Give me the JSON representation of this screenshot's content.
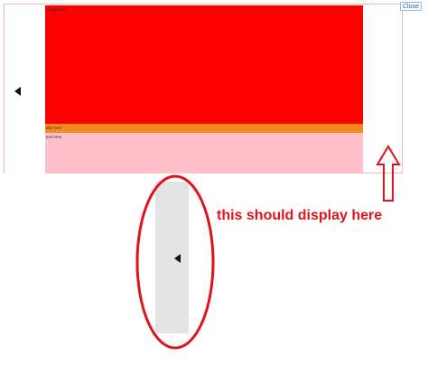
{
  "panel": {
    "red_text": "image here",
    "orange_text": "title here",
    "pink_text": "text here"
  },
  "close_label": "Close",
  "annotation": "this should display here",
  "icons": {
    "left_arrow": "triangle-left-icon",
    "slide_arrow": "triangle-left-icon",
    "up_arrow": "up-arrow-icon"
  },
  "colors": {
    "red": "#ff0000",
    "orange": "#f58a1f",
    "pink": "#ffc0cb",
    "gray": "#e3e3e3",
    "annotation": "#e2121b"
  }
}
